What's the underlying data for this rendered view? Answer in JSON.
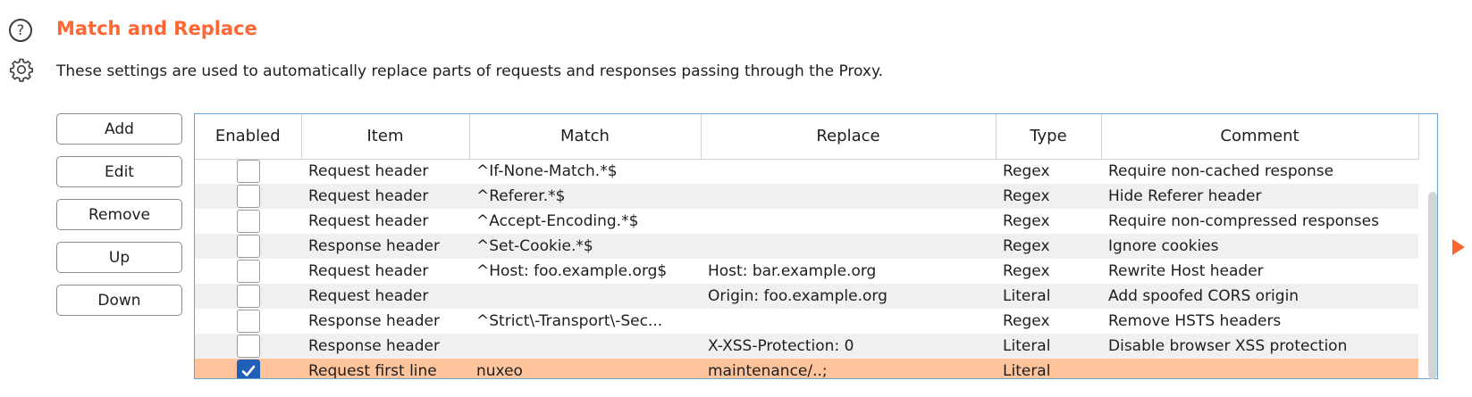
{
  "section": {
    "title": "Match and Replace",
    "description": "These settings are used to automatically replace parts of requests and responses passing through the Proxy.",
    "help_icon_glyph": "?",
    "accent_color": "#ff6633"
  },
  "buttons": {
    "add": "Add",
    "edit": "Edit",
    "remove": "Remove",
    "up": "Up",
    "down": "Down"
  },
  "table": {
    "columns": [
      "Enabled",
      "Item",
      "Match",
      "Replace",
      "Type",
      "Comment"
    ],
    "selected_row_color": "#ffc49c",
    "rows": [
      {
        "enabled": false,
        "item": "Request header",
        "match": "^If-None-Match.*$",
        "replace": "",
        "type": "Regex",
        "comment": "Require non-cached response"
      },
      {
        "enabled": false,
        "item": "Request header",
        "match": "^Referer.*$",
        "replace": "",
        "type": "Regex",
        "comment": "Hide Referer header"
      },
      {
        "enabled": false,
        "item": "Request header",
        "match": "^Accept-Encoding.*$",
        "replace": "",
        "type": "Regex",
        "comment": "Require non-compressed responses"
      },
      {
        "enabled": false,
        "item": "Response header",
        "match": "^Set-Cookie.*$",
        "replace": "",
        "type": "Regex",
        "comment": "Ignore cookies"
      },
      {
        "enabled": false,
        "item": "Request header",
        "match": "^Host: foo.example.org$",
        "replace": "Host: bar.example.org",
        "type": "Regex",
        "comment": "Rewrite Host header"
      },
      {
        "enabled": false,
        "item": "Request header",
        "match": "",
        "replace": "Origin: foo.example.org",
        "type": "Literal",
        "comment": "Add spoofed CORS origin"
      },
      {
        "enabled": false,
        "item": "Response header",
        "match": "^Strict\\-Transport\\-Sec...",
        "replace": "",
        "type": "Regex",
        "comment": "Remove HSTS headers"
      },
      {
        "enabled": false,
        "item": "Response header",
        "match": "",
        "replace": "X-XSS-Protection: 0",
        "type": "Literal",
        "comment": "Disable browser XSS protection"
      },
      {
        "enabled": true,
        "item": "Request first line",
        "match": "nuxeo",
        "replace": "maintenance/..;",
        "type": "Literal",
        "comment": "",
        "selected": true
      }
    ]
  }
}
